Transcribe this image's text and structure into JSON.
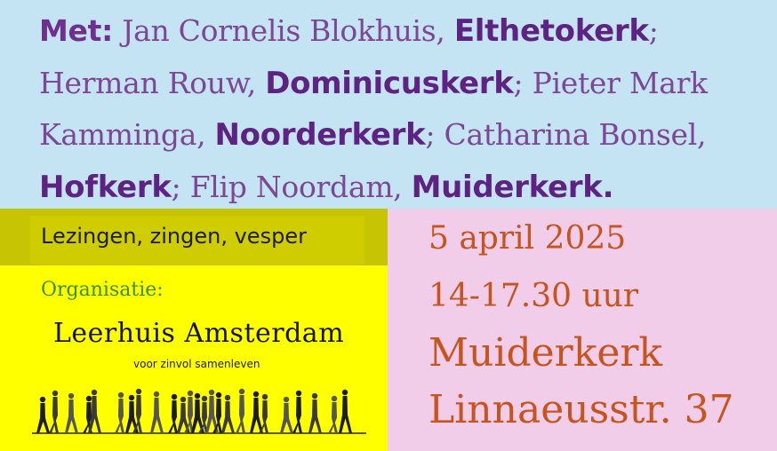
{
  "speakers": {
    "lead": "Met:",
    "entries": [
      {
        "name": "Jan Cornelis Blokhuis,",
        "church": "Elthetokerk",
        "sep": ";"
      },
      {
        "name": "Herman Rouw,",
        "church": "Dominicuskerk",
        "sep": ";"
      },
      {
        "name": "Pieter Mark Kamminga,",
        "church": "Noorderkerk",
        "sep": ";"
      },
      {
        "name": "Catharina Bonsel,",
        "church": "Hofkerk",
        "sep": ";"
      },
      {
        "name": "Flip Noordam,",
        "church": "Muiderkerk.",
        "sep": ""
      }
    ]
  },
  "program": "Lezingen, zingen, vesper",
  "organisation": {
    "label": "Organisatie:",
    "name": "Leerhuis Amsterdam",
    "tagline": "voor zinvol samenleven",
    "logo_icon": "walking-people-silhouettes-icon"
  },
  "event": {
    "date": "5 april 2025",
    "time": "14-17.30 uur",
    "venue": "Muiderkerk",
    "address": "Linnaeusstr. 37"
  },
  "colors": {
    "top_bg": "#c4e3f3",
    "band_bg": "#c7c503",
    "yellow_bg": "#ffff00",
    "pink_bg": "#f1cdea",
    "purple_text": "#7d4697",
    "orange_text": "#c6541c",
    "green_text": "#3a8f2a"
  }
}
